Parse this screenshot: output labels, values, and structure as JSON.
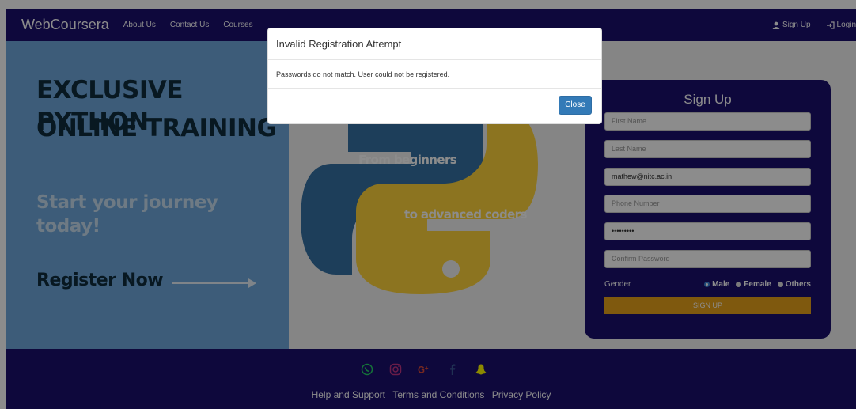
{
  "navbar": {
    "brand": "WebCoursera",
    "links": [
      "About Us",
      "Contact Us",
      "Courses"
    ],
    "signup": "Sign Up",
    "login": "Login"
  },
  "hero": {
    "headline_line1": "EXCLUSIVE PYTHON",
    "headline_line2": "ONLINE TRAINING",
    "subline_line1": "Start your journey",
    "subline_line2": "today!",
    "register": "Register Now",
    "python_text_1": "From beginners",
    "python_text_2": "to advanced coders"
  },
  "signup_form": {
    "title": "Sign Up",
    "first_name_placeholder": "First Name",
    "last_name_placeholder": "Last Name",
    "email_value": "mathew@nitc.ac.in",
    "phone_placeholder": "Phone Number",
    "password_value": "•••••••••",
    "confirm_password_placeholder": "Confirm Password",
    "gender_label": "Gender",
    "gender_options": [
      "Male",
      "Female",
      "Others"
    ],
    "gender_selected": "Male",
    "submit_label": "SIGN UP"
  },
  "footer": {
    "social_icons": [
      "whatsapp-icon",
      "instagram-icon",
      "google-plus-icon",
      "facebook-icon",
      "snapchat-icon"
    ],
    "links": [
      "Help and Support",
      "Terms and Conditions",
      "Privacy Policy"
    ]
  },
  "modal": {
    "title": "Invalid Registration Attempt",
    "message": "Passwords do not match. User could not be registered.",
    "close_label": "Close"
  },
  "colors": {
    "navy": "#1b0f6e",
    "hero_blue": "#6fa8dc",
    "accent_orange": "#e8a21a",
    "python_blue": "#3572a5",
    "python_yellow": "#ffd43b",
    "button_blue": "#337ab7"
  }
}
